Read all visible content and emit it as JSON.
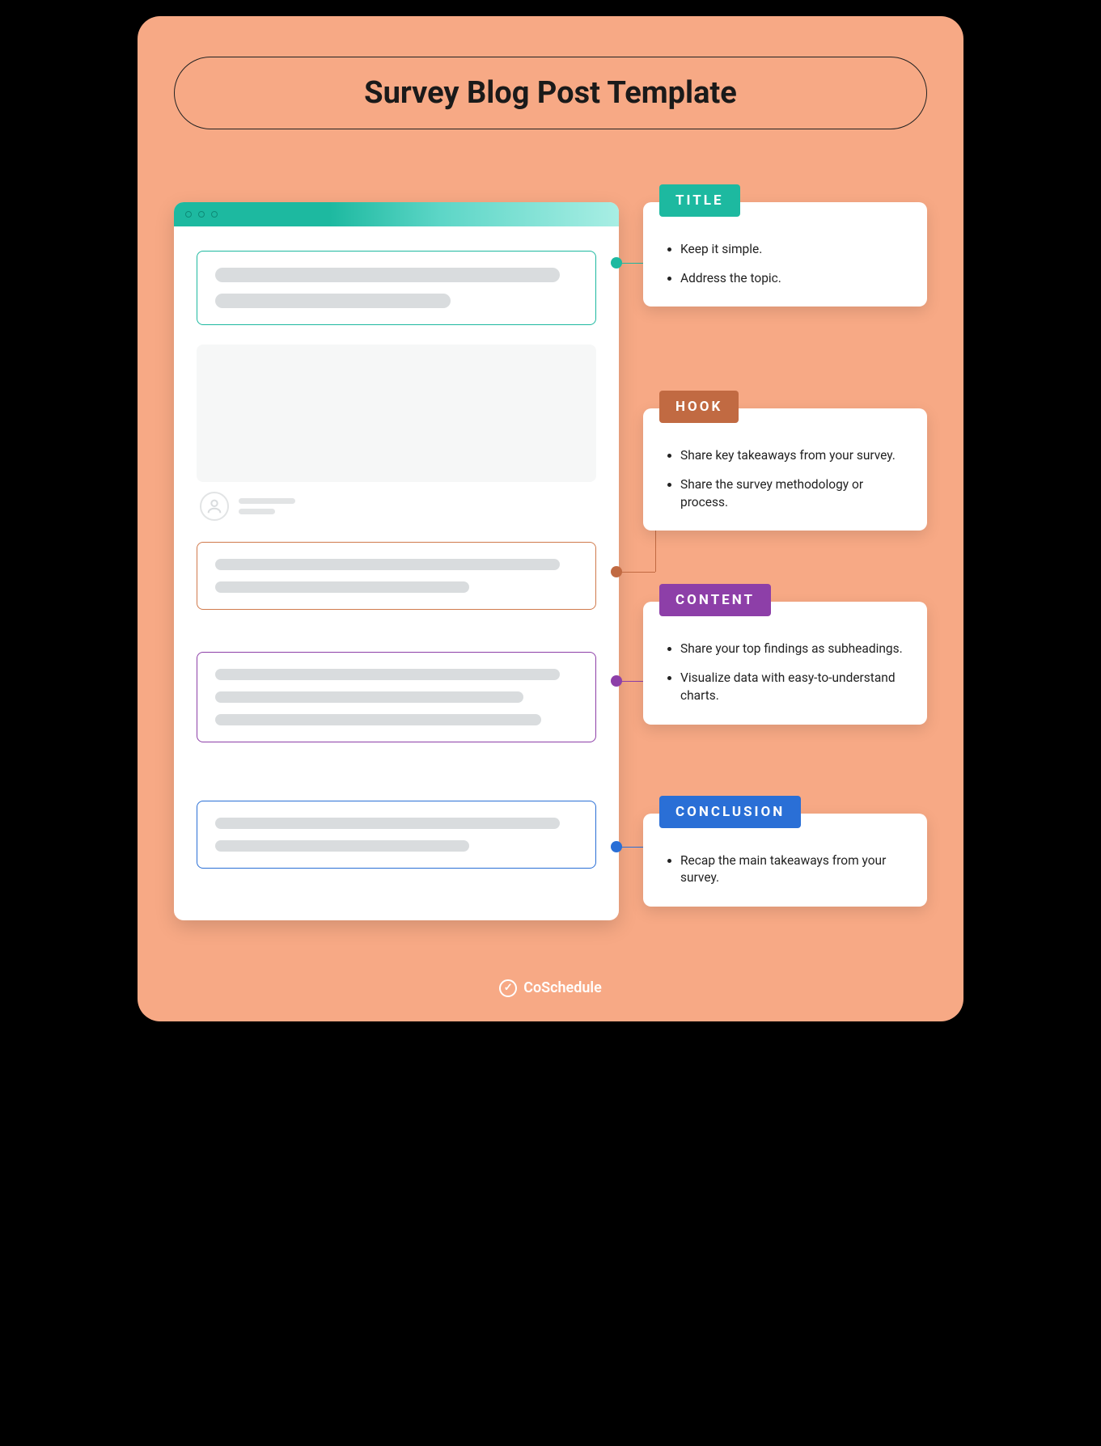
{
  "page_title": "Survey Blog Post Template",
  "brand": "CoSchedule",
  "callouts": {
    "title": {
      "label": "TITLE",
      "items": [
        "Keep it simple.",
        "Address the topic."
      ]
    },
    "hook": {
      "label": "HOOK",
      "items": [
        "Share key takeaways from your survey.",
        "Share the survey methodology or process."
      ]
    },
    "content": {
      "label": "CONTENT",
      "items": [
        "Share your top findings as subheadings.",
        "Visualize data with easy-to-understand charts."
      ]
    },
    "conclusion": {
      "label": "CONCLUSION",
      "items": [
        "Recap the main takeaways from your survey."
      ]
    }
  },
  "colors": {
    "title": "#1db9a0",
    "hook": "#c16a42",
    "content": "#8d3fa8",
    "conclusion": "#2a6fd6",
    "background": "#f7a985"
  }
}
